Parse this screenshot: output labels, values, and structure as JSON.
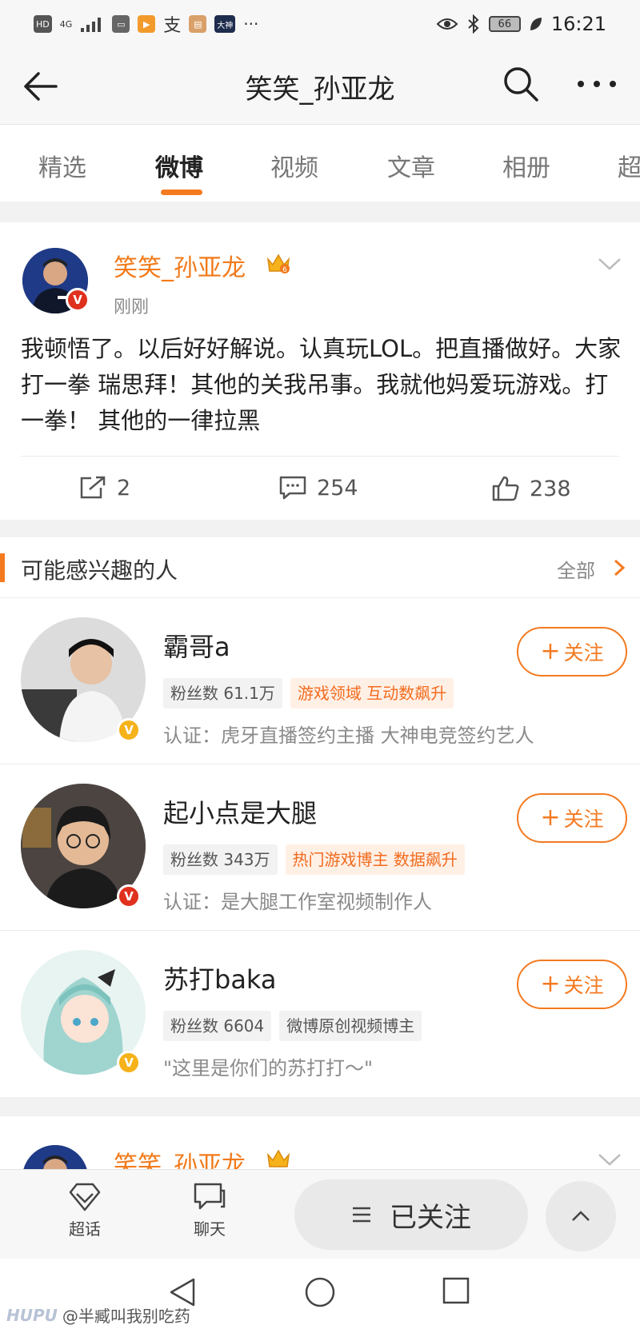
{
  "status_bar": {
    "hd": "HD",
    "network": "4G",
    "time": "16:21",
    "battery": "66",
    "more": "···"
  },
  "header": {
    "title": "笑笑_孙亚龙"
  },
  "tabs": [
    {
      "label": "精选"
    },
    {
      "label": "微博"
    },
    {
      "label": "视频"
    },
    {
      "label": "文章"
    },
    {
      "label": "相册"
    },
    {
      "label": "超"
    }
  ],
  "post": {
    "author": "笑笑_孙亚龙",
    "time": "刚刚",
    "text": "我顿悟了。以后好好解说。认真玩LOL。把直播做好。大家打一拳 瑞思拜！其他的关我吊事。我就他妈爱玩游戏。打一拳！ 其他的一律拉黑",
    "reposts": "2",
    "comments": "254",
    "likes": "238"
  },
  "recommend": {
    "title": "可能感兴趣的人",
    "all": "全部",
    "follow_label": "关注",
    "people": [
      {
        "name": "霸哥a",
        "fans": "粉丝数 61.1万",
        "tag": "游戏领域 互动数飙升",
        "desc": "认证：虎牙直播签约主播 大神电竞签约艺人"
      },
      {
        "name": "起小点是大腿",
        "fans": "粉丝数 343万",
        "tag": "热门游戏博主 数据飙升",
        "desc": "认证：是大腿工作室视频制作人"
      },
      {
        "name": "苏打baka",
        "fans": "粉丝数 6604",
        "tag": "微博原创视频博主",
        "desc": "\"这里是你们的苏打打～\""
      }
    ]
  },
  "next_post": {
    "author": "笑笑_孙亚龙"
  },
  "bottom_bar": {
    "supertopic": "超话",
    "chat": "聊天",
    "followed": "已关注"
  },
  "watermark": {
    "brand": "HUPU",
    "user": "@半臧叫我别吃药"
  },
  "colors": {
    "accent": "#f47a20",
    "verified_red": "#e0301e",
    "verified_gold": "#f6b21a"
  }
}
